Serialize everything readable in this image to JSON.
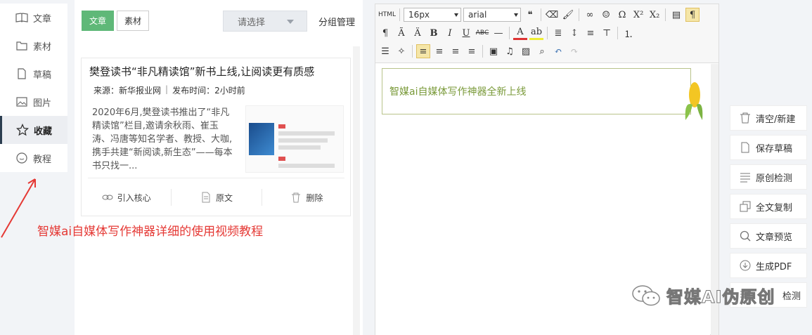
{
  "nav": {
    "items": [
      {
        "label": "文章",
        "icon": "book-icon"
      },
      {
        "label": "素材",
        "icon": "folder-icon"
      },
      {
        "label": "草稿",
        "icon": "draft-icon"
      },
      {
        "label": "图片",
        "icon": "image-icon"
      },
      {
        "label": "收藏",
        "icon": "star-icon",
        "active": true
      },
      {
        "label": "教程",
        "icon": "circle-icon"
      }
    ]
  },
  "mid": {
    "tabs": {
      "article": "文章",
      "material": "素材"
    },
    "select_placeholder": "请选择",
    "group_manage": "分组管理",
    "card": {
      "title": "樊登读书“非凡精读馆”新书上线,让阅读更有质感",
      "source": "来源：新华报业网",
      "time": "发布时间：2小时前",
      "summary": "2020年6月,樊登读书推出了“非凡精读馆”栏目,邀请余秋雨、崔玉涛、冯唐等知名学者、教授、大咖,携手共建“新阅读,新生态”——每本书只找一...",
      "actions": {
        "cite": "引入核心",
        "original": "原文",
        "delete": "删除"
      }
    }
  },
  "annotation": "智媒ai自媒体写作神器详细的使用视频教程",
  "editor": {
    "toolbar": {
      "html_label": "HTML",
      "font_size": "16px",
      "font_family": "arial",
      "quote": "❝",
      "bold": "B",
      "italic": "I",
      "underline": "U",
      "strike": "ABC",
      "font_color": "A",
      "superscript": "X²",
      "subscript": "X₂",
      "omega": "Ω"
    },
    "banner_text": "智媒ai自媒体写作神器全新上线"
  },
  "side": {
    "buttons": [
      {
        "label": "清空/新建",
        "icon": "trash-icon"
      },
      {
        "label": "保存草稿",
        "icon": "document-icon"
      },
      {
        "label": "原创检测",
        "icon": "lines-icon"
      },
      {
        "label": "全文复制",
        "icon": "copy-icon"
      },
      {
        "label": "文章预览",
        "icon": "search-icon"
      },
      {
        "label": "生成PDF",
        "icon": "download-icon"
      },
      {
        "label": "检测",
        "icon": "lines-icon"
      }
    ]
  },
  "watermark": "智媒AI伪原创",
  "colors": {
    "accent_green": "#5fb878",
    "annotation_red": "#e53935",
    "banner_green": "#7a9a3a"
  }
}
